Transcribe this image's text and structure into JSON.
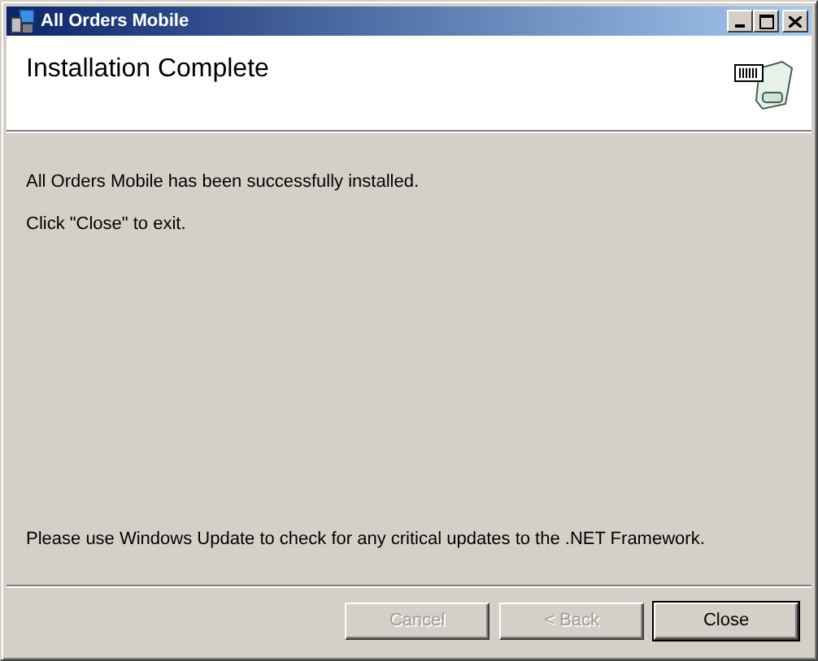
{
  "window": {
    "title": "All Orders Mobile"
  },
  "header": {
    "title": "Installation Complete"
  },
  "body": {
    "messages": [
      "All Orders Mobile has been successfully installed.",
      "Click \"Close\" to exit."
    ],
    "note": "Please use Windows Update to check for any critical updates to the .NET Framework."
  },
  "buttons": [
    {
      "label": "Cancel",
      "disabled": true,
      "default": false
    },
    {
      "label": "< Back",
      "disabled": true,
      "default": false
    },
    {
      "label": "Close",
      "disabled": false,
      "default": true
    }
  ]
}
